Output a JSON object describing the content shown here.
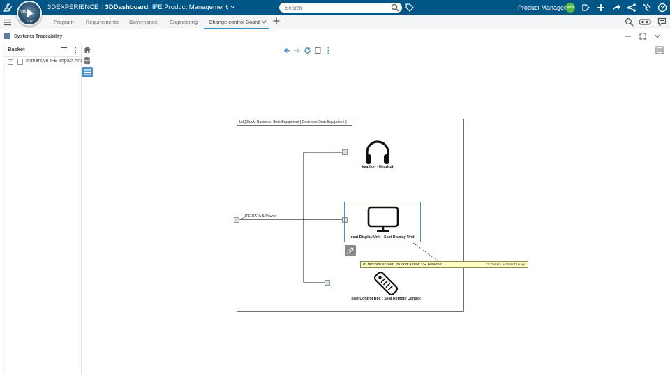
{
  "topbar": {
    "brand_app": "3DEXPERIENCE",
    "brand_sep": "|",
    "brand_dashboard": "3DDashboard",
    "brand_context": "IFE Product Management",
    "compass_label": "3D",
    "compass_version": "V,R",
    "search_placeholder": "Search",
    "role": "Product Manager",
    "avatar_initials": "PPP",
    "bar_color": "#005686"
  },
  "tabs": [
    {
      "label": "Program"
    },
    {
      "label": "Requirements"
    },
    {
      "label": "Governance"
    },
    {
      "label": "Engineering"
    },
    {
      "label": "Change control Board",
      "active": true
    }
  ],
  "widget": {
    "title": "Systems Traceability"
  },
  "basket": {
    "title": "Basket",
    "items": [
      {
        "label": "Immersive IFE Impact Analysis",
        "expand": "+"
      }
    ]
  },
  "diagram": {
    "frame_title": "ibd [Block] Business Seat Equipment [ Business Seat Equipment ]",
    "parts": [
      {
        "label": "headset : Headset",
        "icon": "headphones-icon"
      },
      {
        "label": "seat Display Unit : Seat Display Unit",
        "icon": "monitor-icon"
      },
      {
        "label": "seat Control Box : Seat Remote Control",
        "icon": "remote-control-icon"
      }
    ],
    "connector_label": "IFE DATA & Power",
    "note": {
      "text": "To remove screen, to add a new VR Headset",
      "meta": "17 System Architect 1d ago"
    },
    "selection_color": "#4a90c9"
  }
}
